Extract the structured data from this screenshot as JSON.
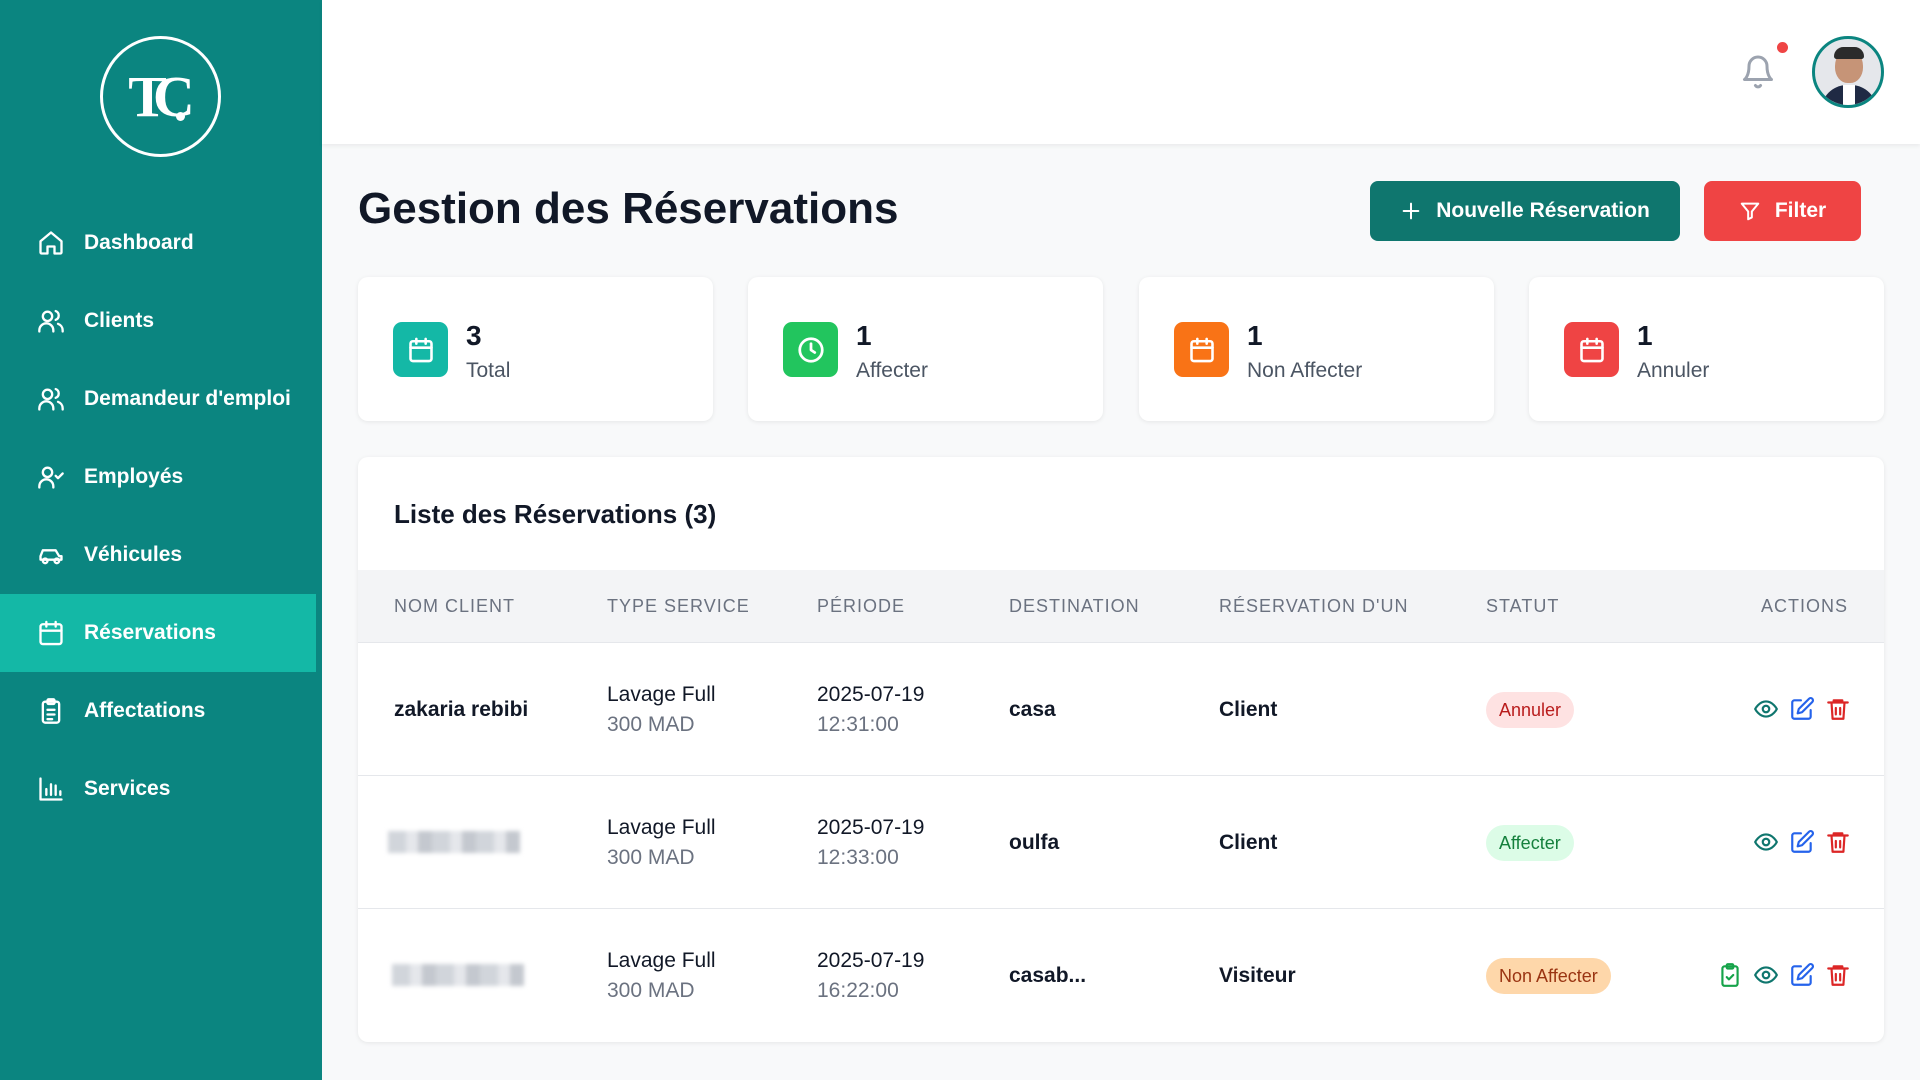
{
  "brand": {
    "logo_text": "TC"
  },
  "sidebar": {
    "items": [
      {
        "label": "Dashboard",
        "icon": "home-icon"
      },
      {
        "label": "Clients",
        "icon": "users-icon"
      },
      {
        "label": "Demandeur d'emploi",
        "icon": "users-icon"
      },
      {
        "label": "Employés",
        "icon": "user-check-icon"
      },
      {
        "label": "Véhicules",
        "icon": "car-icon"
      },
      {
        "label": "Réservations",
        "icon": "calendar-icon",
        "active": true
      },
      {
        "label": "Affectations",
        "icon": "clipboard-list-icon"
      },
      {
        "label": "Services",
        "icon": "bar-chart-icon"
      }
    ]
  },
  "topbar": {
    "has_notification": true
  },
  "header": {
    "title": "Gestion des Réservations",
    "new_button": "Nouvelle Réservation",
    "filter_button": "Filter"
  },
  "stats": [
    {
      "value": "3",
      "label": "Total",
      "color": "#14b8a6"
    },
    {
      "value": "1",
      "label": "Affecter",
      "color": "#22c55e"
    },
    {
      "value": "1",
      "label": "Non Affecter",
      "color": "#f97316"
    },
    {
      "value": "1",
      "label": "Annuler",
      "color": "#ef4444"
    }
  ],
  "table": {
    "title": "Liste des Réservations (3)",
    "columns": [
      "NOM CLIENT",
      "TYPE SERVICE",
      "PÉRIODE",
      "DESTINATION",
      "RÉSERVATION D'UN",
      "STATUT",
      "ACTIONS"
    ],
    "rows": [
      {
        "client": "zakaria rebibi",
        "service": "Lavage Full",
        "price": "300 MAD",
        "date": "2025-07-19",
        "time": "12:31:00",
        "destination": "casa",
        "reservation_by": "Client",
        "status": "Annuler"
      },
      {
        "client": "",
        "service": "Lavage Full",
        "price": "300 MAD",
        "date": "2025-07-19",
        "time": "12:33:00",
        "destination": "oulfa",
        "reservation_by": "Client",
        "status": "Affecter"
      },
      {
        "client": "",
        "service": "Lavage Full",
        "price": "300 MAD",
        "date": "2025-07-19",
        "time": "16:22:00",
        "destination": "casab...",
        "reservation_by": "Visiteur",
        "status": "Non Affecter"
      }
    ]
  },
  "colors": {
    "sidebar": "#0b8580",
    "sidebar_active": "#14b8a6",
    "primary_button": "#0f766e",
    "danger_button": "#ef4444"
  }
}
